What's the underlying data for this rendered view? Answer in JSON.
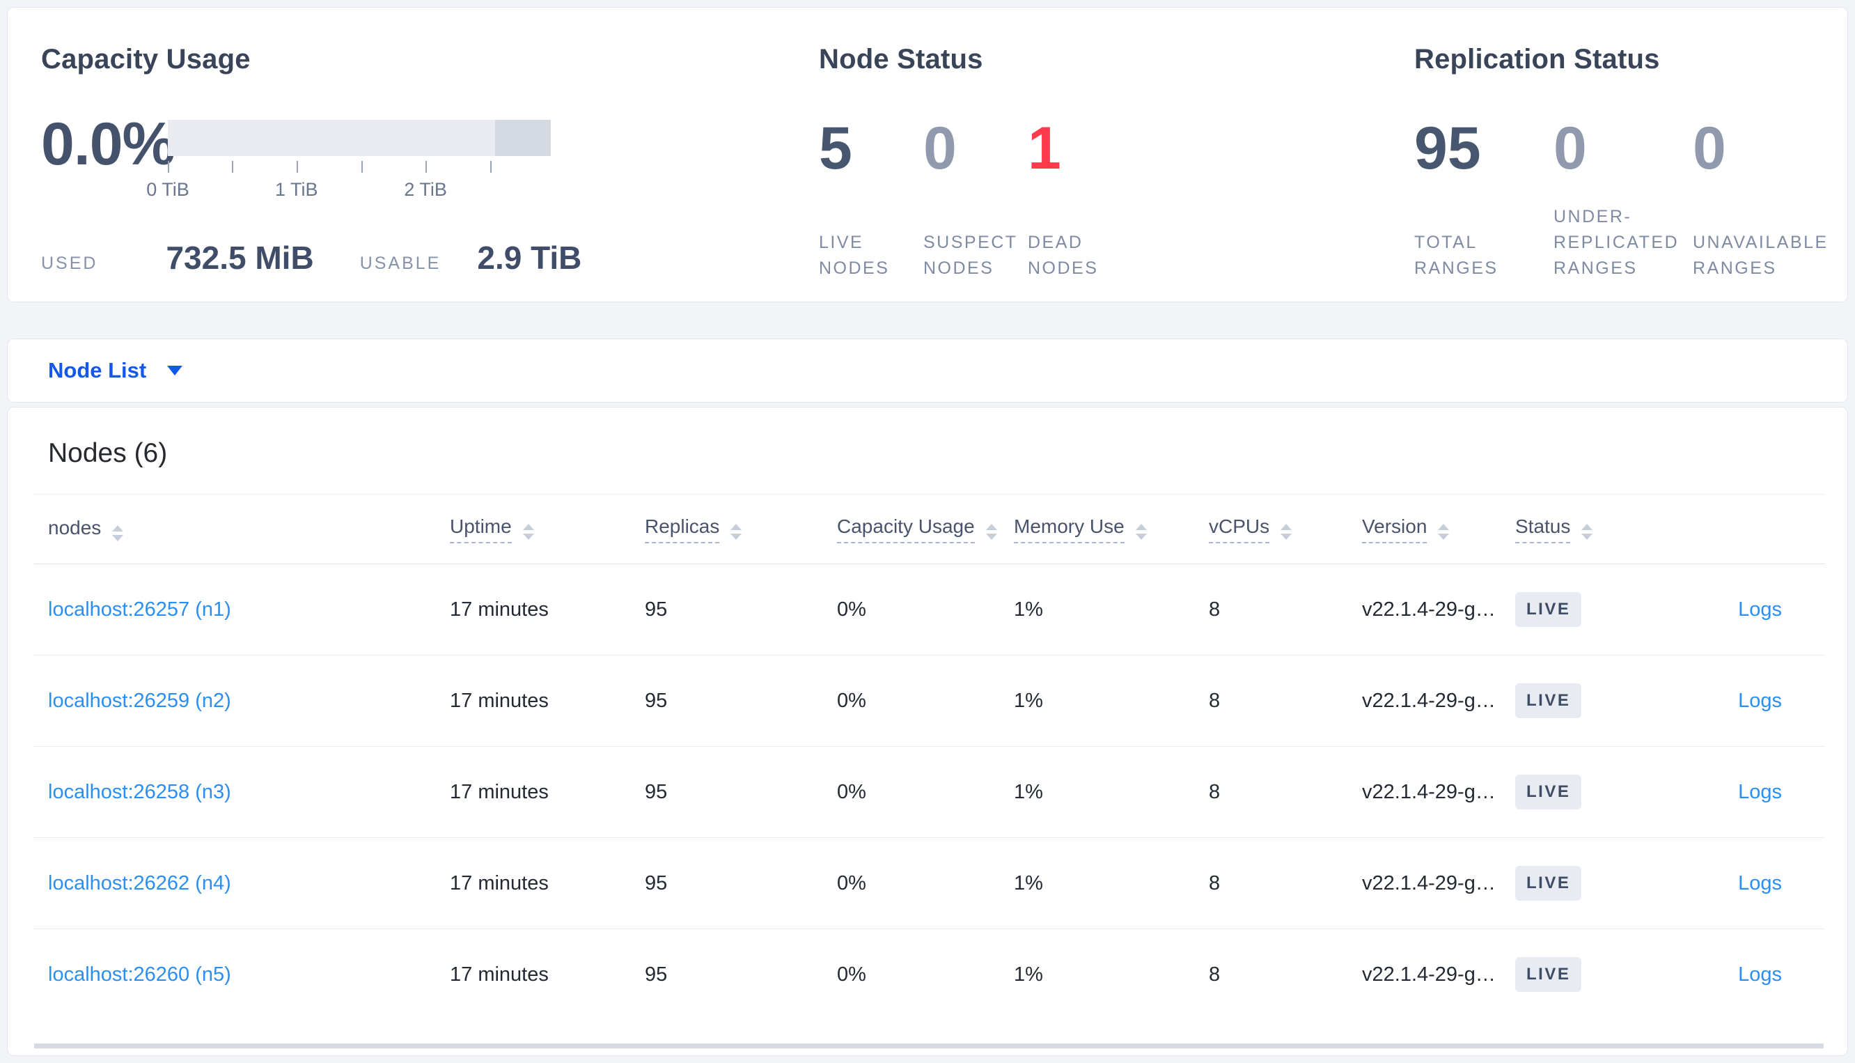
{
  "colors": {
    "accent_blue": "#1458e8",
    "link_blue": "#2a8ff2",
    "danger_red": "#ff3a4d",
    "stat_dark": "#475770",
    "stat_muted": "#9099ae",
    "badge_bg": "#e8ecf2"
  },
  "summary": {
    "capacity": {
      "title": "Capacity Usage",
      "percent_used": "0.0%",
      "axis_ticks": [
        "0 TiB",
        "1 TiB",
        "2 TiB"
      ],
      "used_label": "USED",
      "used_value": "732.5 MiB",
      "usable_label": "USABLE",
      "usable_value": "2.9 TiB"
    },
    "node_status": {
      "title": "Node Status",
      "stats": [
        {
          "value": "5",
          "label": "LIVE NODES",
          "tone": "dark"
        },
        {
          "value": "0",
          "label": "SUSPECT NODES",
          "tone": "muted"
        },
        {
          "value": "1",
          "label": "DEAD NODES",
          "tone": "danger"
        }
      ]
    },
    "replication_status": {
      "title": "Replication Status",
      "stats": [
        {
          "value": "95",
          "label": "TOTAL RANGES",
          "tone": "dark"
        },
        {
          "value": "0",
          "label": "UNDER-REPLICATED RANGES",
          "tone": "muted"
        },
        {
          "value": "0",
          "label": "UNAVAILABLE RANGES",
          "tone": "muted"
        }
      ]
    }
  },
  "view_selector": {
    "label": "Node List"
  },
  "nodes_section": {
    "heading": "Nodes (6)",
    "columns": [
      {
        "label": "nodes",
        "underlined": false
      },
      {
        "label": "Uptime",
        "underlined": true
      },
      {
        "label": "Replicas",
        "underlined": true
      },
      {
        "label": "Capacity Usage",
        "underlined": true
      },
      {
        "label": "Memory Use",
        "underlined": true
      },
      {
        "label": "vCPUs",
        "underlined": true
      },
      {
        "label": "Version",
        "underlined": true
      },
      {
        "label": "Status",
        "underlined": true
      }
    ],
    "rows": [
      {
        "node": "localhost:26257 (n1)",
        "uptime": "17 minutes",
        "replicas": "95",
        "capacity_usage": "0%",
        "memory_use": "1%",
        "vcpus": "8",
        "version": "v22.1.4-29-g…",
        "status": "LIVE",
        "logs_label": "Logs"
      },
      {
        "node": "localhost:26259 (n2)",
        "uptime": "17 minutes",
        "replicas": "95",
        "capacity_usage": "0%",
        "memory_use": "1%",
        "vcpus": "8",
        "version": "v22.1.4-29-g…",
        "status": "LIVE",
        "logs_label": "Logs"
      },
      {
        "node": "localhost:26258 (n3)",
        "uptime": "17 minutes",
        "replicas": "95",
        "capacity_usage": "0%",
        "memory_use": "1%",
        "vcpus": "8",
        "version": "v22.1.4-29-g…",
        "status": "LIVE",
        "logs_label": "Logs"
      },
      {
        "node": "localhost:26262 (n4)",
        "uptime": "17 minutes",
        "replicas": "95",
        "capacity_usage": "0%",
        "memory_use": "1%",
        "vcpus": "8",
        "version": "v22.1.4-29-g…",
        "status": "LIVE",
        "logs_label": "Logs"
      },
      {
        "node": "localhost:26260 (n5)",
        "uptime": "17 minutes",
        "replicas": "95",
        "capacity_usage": "0%",
        "memory_use": "1%",
        "vcpus": "8",
        "version": "v22.1.4-29-g…",
        "status": "LIVE",
        "logs_label": "Logs"
      }
    ]
  }
}
